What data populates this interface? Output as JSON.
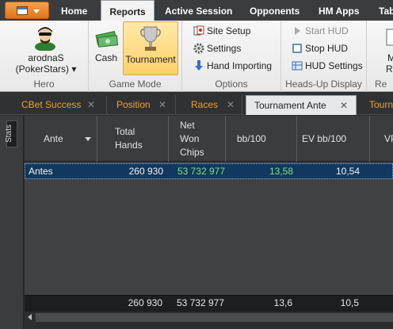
{
  "menu": {
    "tabs": [
      "Home",
      "Reports",
      "Active Session",
      "Opponents",
      "HM Apps",
      "Tab"
    ],
    "active": "Reports"
  },
  "ribbon": {
    "hero": {
      "name": "arodnaS",
      "site": "(PokerStars)",
      "label": "Hero"
    },
    "game_mode": {
      "cash": "Cash",
      "tournament": "Tournament",
      "label": "Game Mode"
    },
    "options": {
      "site_setup": "Site Setup",
      "settings": "Settings",
      "hand_importing": "Hand Importing",
      "label": "Options"
    },
    "hud": {
      "start": "Start HUD",
      "stop": "Stop HUD",
      "settings": "HUD Settings",
      "label": "Heads-Up Display"
    },
    "more": {
      "line1": "M",
      "line2": "Rep",
      "label": "Re"
    }
  },
  "report_tabs": [
    "CBet Success",
    "Position",
    "Races",
    "Tournament Ante",
    "Tourn"
  ],
  "active_report_tab": "Tournament Ante",
  "stats_label": "Stats",
  "grid": {
    "columns": [
      {
        "label": "Ante"
      },
      {
        "label": "Total Hands"
      },
      {
        "label": "Net Won Chips"
      },
      {
        "label": "bb/100"
      },
      {
        "label": "EV bb/100"
      },
      {
        "label": "VP"
      }
    ],
    "rows": [
      {
        "ante": "Antes",
        "total_hands": "260 930",
        "net_won": "53 732 977",
        "bb100": "13,58",
        "ev_bb100": "10,54"
      }
    ],
    "totals": {
      "total_hands": "260 930",
      "net_won": "53 732 977",
      "bb100": "13,6",
      "ev_bb100": "10,5"
    }
  },
  "colors": {
    "accent_orange": "#f0a030",
    "selected_row": "#13385f",
    "positive_green": "#7ee07e"
  }
}
